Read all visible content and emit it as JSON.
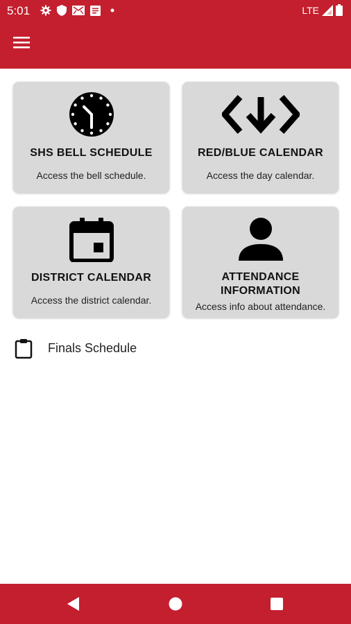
{
  "status_bar": {
    "time": "5:01",
    "network": "LTE",
    "icons": [
      "gear-icon",
      "shield-icon",
      "mail-icon",
      "document-icon",
      "dot-icon",
      "signal-icon",
      "battery-icon"
    ]
  },
  "app_bar": {
    "menu_icon": "hamburger-menu-icon"
  },
  "cards": [
    {
      "title": "SHS BELL SCHEDULE",
      "subtitle": "Access the bell schedule.",
      "icon": "clock-icon"
    },
    {
      "title": "RED/BLUE CALENDAR",
      "subtitle": "Access the day calendar.",
      "icon": "swap-arrows-icon"
    },
    {
      "title": "DISTRICT CALENDAR",
      "subtitle": "Access the district calendar.",
      "icon": "calendar-icon"
    },
    {
      "title": "ATTENDANCE INFORMATION",
      "title_line1": "ATTENDANCE",
      "title_line2": "INFORMATION",
      "subtitle": "Access info about attendance.",
      "icon": "person-icon"
    }
  ],
  "list_items": [
    {
      "label": "Finals Schedule",
      "icon": "clipboard-icon"
    }
  ],
  "nav_bar": {
    "icons": [
      "back-icon",
      "home-icon",
      "recents-icon"
    ]
  },
  "colors": {
    "primary": "#c41f2e",
    "card_bg": "#d9d9d9"
  }
}
